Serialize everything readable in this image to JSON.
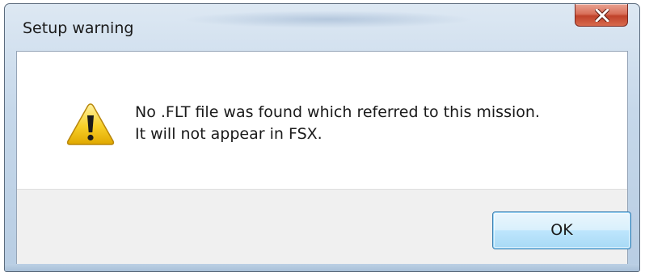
{
  "window": {
    "title": "Setup warning",
    "close_glyph": "X",
    "close_icon": "close-icon",
    "accent_close": "#c0422a",
    "frame_color": "#c6d8ea"
  },
  "dialog": {
    "icon": "warning-icon",
    "message_line_1": "No .FLT file was found which referred to this mission.",
    "message_line_2": "It will not appear in FSX.",
    "ok_label": "OK"
  }
}
